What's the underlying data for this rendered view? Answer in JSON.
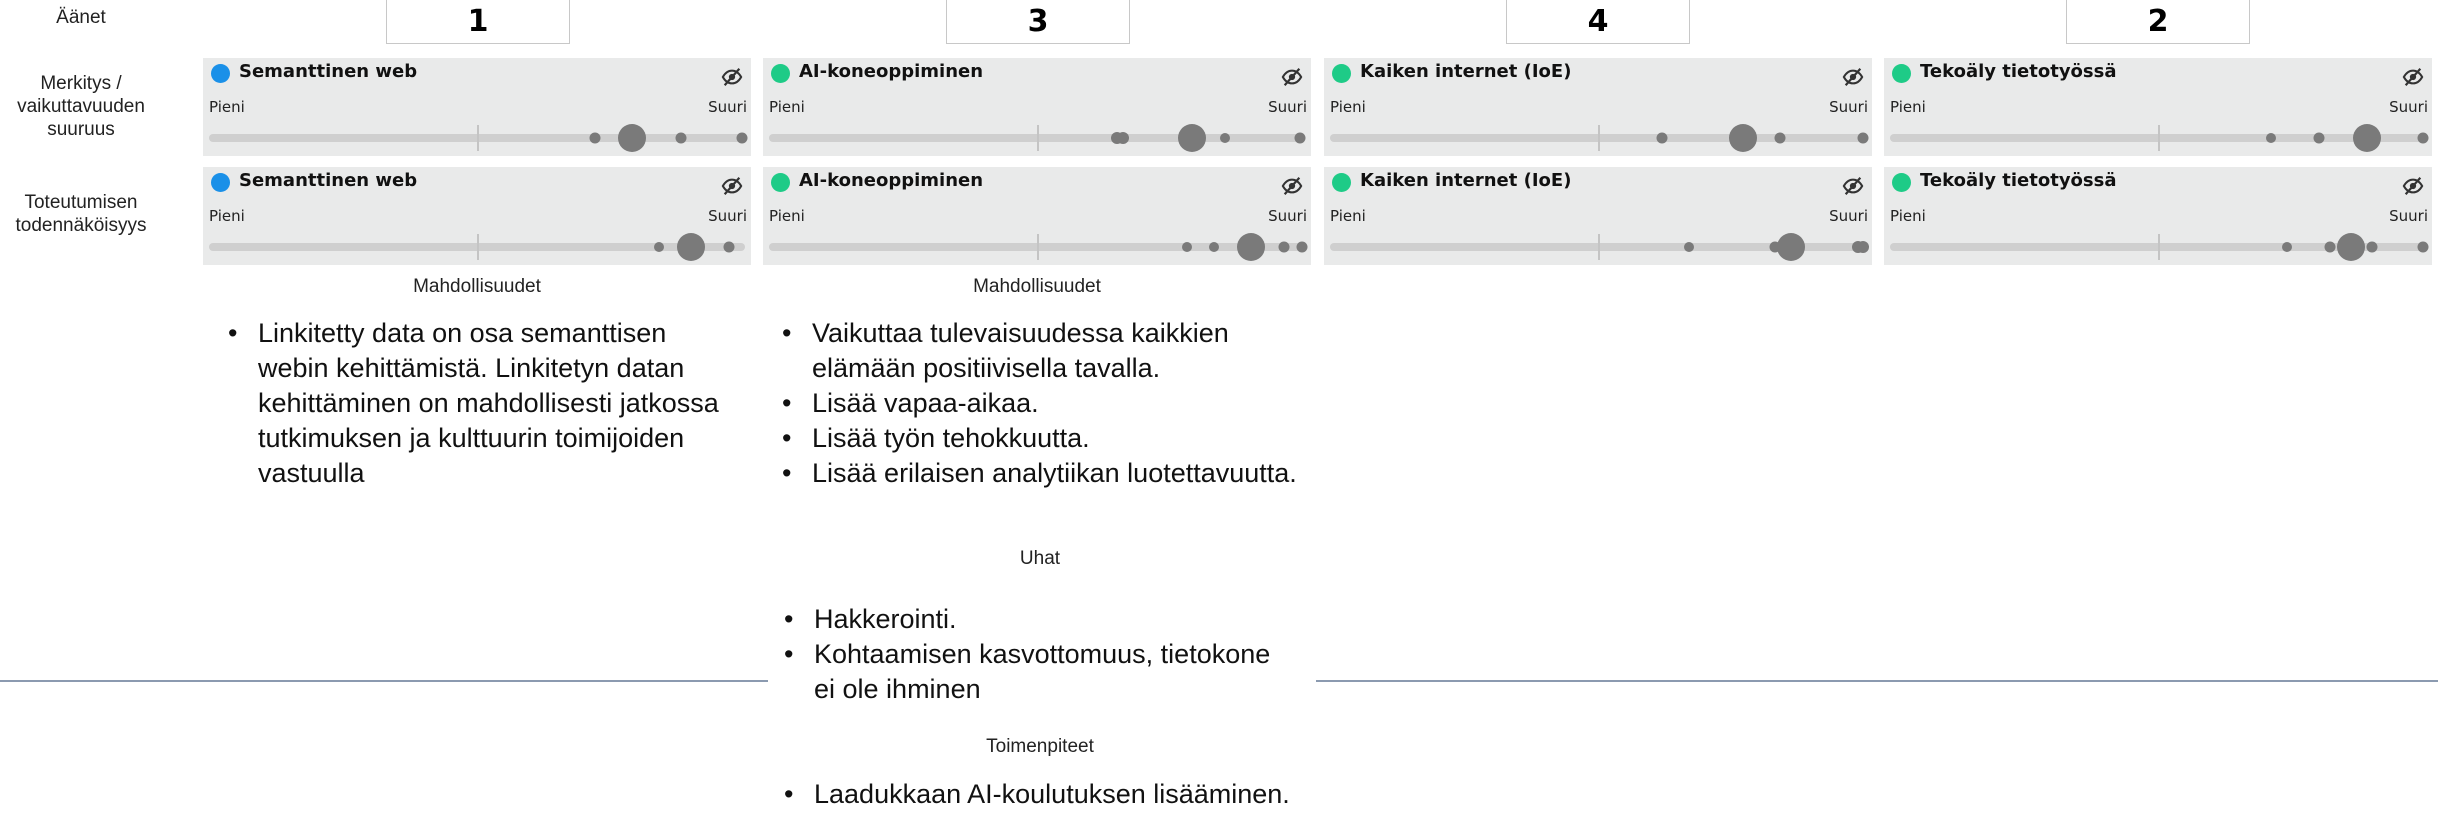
{
  "row_labels": {
    "votes": "Äänet",
    "impact": "Merkitys / vaikuttavuuden suuruus",
    "probability": "Toteutumisen todennäköisyys"
  },
  "scale": {
    "min_label": "Pieni",
    "max_label": "Suuri"
  },
  "icons": {
    "hide": "eye-slash-icon"
  },
  "columns": [
    {
      "vote_count": "1",
      "title": "Semanttinen web",
      "dot_color": "#1a90e8",
      "impact_votes": [
        {
          "v": 0.72,
          "s": 11
        },
        {
          "v": 0.79,
          "s": 28
        },
        {
          "v": 0.88,
          "s": 11
        },
        {
          "v": 0.995,
          "s": 11
        }
      ],
      "prob_votes": [
        {
          "v": 0.84,
          "s": 10
        },
        {
          "v": 0.9,
          "s": 28
        },
        {
          "v": 0.97,
          "s": 11
        }
      ]
    },
    {
      "vote_count": "3",
      "title": "AI-koneoppiminen",
      "dot_color": "#1ecb87",
      "impact_votes": [
        {
          "v": 0.65,
          "s": 12
        },
        {
          "v": 0.66,
          "s": 12
        },
        {
          "v": 0.79,
          "s": 28
        },
        {
          "v": 0.85,
          "s": 10
        },
        {
          "v": 0.99,
          "s": 11
        }
      ],
      "prob_votes": [
        {
          "v": 0.78,
          "s": 10
        },
        {
          "v": 0.83,
          "s": 10
        },
        {
          "v": 0.9,
          "s": 28
        },
        {
          "v": 0.96,
          "s": 11
        },
        {
          "v": 0.995,
          "s": 11
        }
      ]
    },
    {
      "vote_count": "4",
      "title": "Kaiken internet (IoE)",
      "dot_color": "#1ecb87",
      "impact_votes": [
        {
          "v": 0.62,
          "s": 11
        },
        {
          "v": 0.77,
          "s": 28
        },
        {
          "v": 0.84,
          "s": 11
        },
        {
          "v": 0.995,
          "s": 11
        }
      ],
      "prob_votes": [
        {
          "v": 0.67,
          "s": 10
        },
        {
          "v": 0.83,
          "s": 11
        },
        {
          "v": 0.86,
          "s": 28
        },
        {
          "v": 0.985,
          "s": 12
        },
        {
          "v": 0.995,
          "s": 12
        }
      ]
    },
    {
      "vote_count": "2",
      "title": "Tekoäly tietotyössä",
      "dot_color": "#1ecb87",
      "impact_votes": [
        {
          "v": 0.71,
          "s": 10
        },
        {
          "v": 0.8,
          "s": 11
        },
        {
          "v": 0.89,
          "s": 28
        },
        {
          "v": 0.995,
          "s": 11
        }
      ],
      "prob_votes": [
        {
          "v": 0.74,
          "s": 10
        },
        {
          "v": 0.82,
          "s": 11
        },
        {
          "v": 0.86,
          "s": 28
        },
        {
          "v": 0.9,
          "s": 11
        },
        {
          "v": 0.995,
          "s": 11
        }
      ]
    }
  ],
  "sections": {
    "col1_opportunities_heading": "Mahdollisuudet",
    "col1_opportunities": [
      "Linkitetty data on osa semanttisen webin kehittämistä. Linkitetyn datan kehittäminen on mahdollisesti jatkossa tutkimuksen ja kulttuurin toimijoiden vastuulla"
    ],
    "col2_opportunities_heading": "Mahdollisuudet",
    "col2_opportunities": [
      "Vaikuttaa tulevaisuudessa kaikkien elämään positiivisella tavalla.",
      "Lisää vapaa-aikaa.",
      "Lisää työn tehokkuutta.",
      "Lisää erilaisen analytiikan luotettavuutta."
    ],
    "threats_heading": "Uhat",
    "threats": [
      "Hakkerointi.",
      "Kohtaamisen kasvottomuus, tietokone ei ole ihminen"
    ],
    "actions_heading": "Toimenpiteet",
    "actions": [
      "Laadukkaan AI-koulutuksen lisääminen."
    ]
  }
}
